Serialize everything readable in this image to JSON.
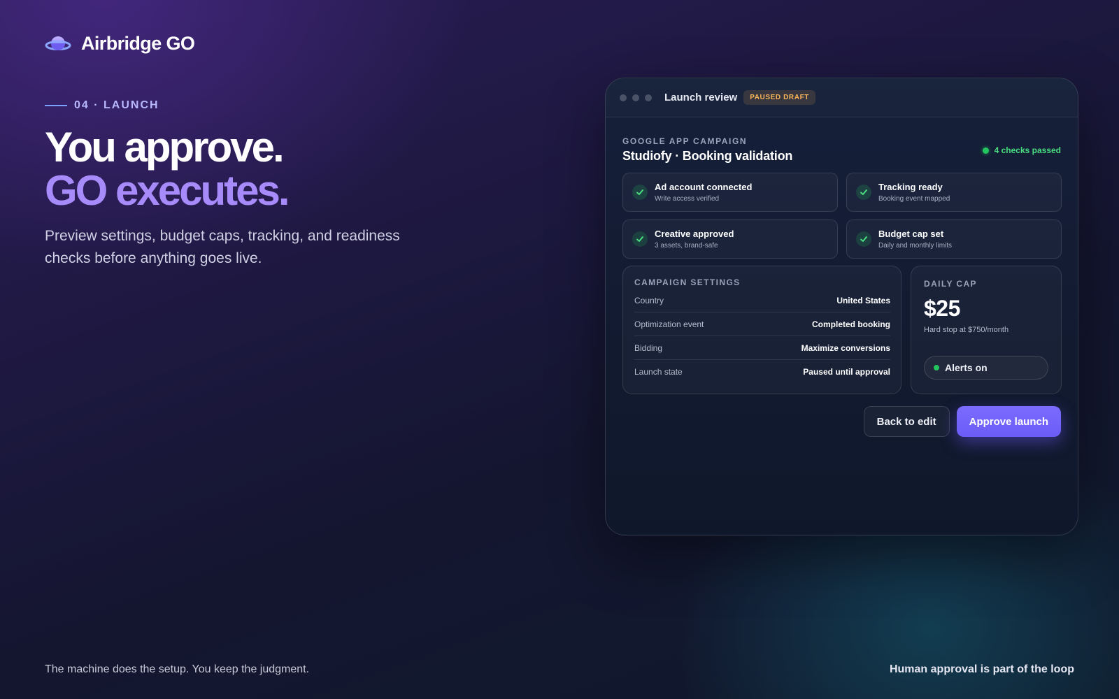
{
  "brand": {
    "name": "Airbridge GO",
    "logo_icon": "planet-icon"
  },
  "hero": {
    "eyebrow": "04 · LAUNCH",
    "headline_line1": "You approve.",
    "headline_line2": "GO executes.",
    "subcopy": "Preview settings, budget caps, tracking, and readiness checks before anything goes live."
  },
  "window": {
    "title": "Launch review",
    "badge": "PAUSED DRAFT",
    "campaign_type": "GOOGLE APP CAMPAIGN",
    "campaign_name": "Studiofy · Booking validation",
    "checks_status": "4 checks passed",
    "checks": [
      {
        "title": "Ad account connected",
        "subtitle": "Write access verified"
      },
      {
        "title": "Tracking ready",
        "subtitle": "Booking event mapped"
      },
      {
        "title": "Creative approved",
        "subtitle": "3 assets, brand-safe"
      },
      {
        "title": "Budget cap set",
        "subtitle": "Daily and monthly limits"
      }
    ],
    "settings": {
      "heading": "CAMPAIGN SETTINGS",
      "rows": [
        {
          "label": "Country",
          "value": "United States"
        },
        {
          "label": "Optimization event",
          "value": "Completed booking"
        },
        {
          "label": "Bidding",
          "value": "Maximize conversions"
        },
        {
          "label": "Launch state",
          "value": "Paused until approval"
        }
      ]
    },
    "daily_cap": {
      "heading": "DAILY CAP",
      "amount": "$25",
      "note": "Hard stop at $750/month",
      "alerts_label": "Alerts on"
    },
    "buttons": {
      "back": "Back to edit",
      "approve": "Approve launch"
    }
  },
  "footer": {
    "left": "The machine does the setup. You keep the judgment.",
    "right": "Human approval is part of the loop"
  },
  "colors": {
    "accent": "#a78bfa",
    "success": "#22c55e",
    "warning": "#f7b45a",
    "primary_button": "#6a5cf5"
  }
}
